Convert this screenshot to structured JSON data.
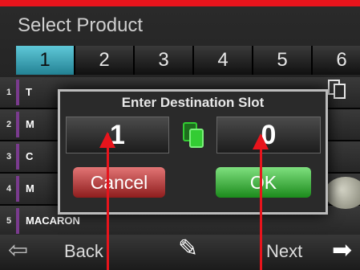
{
  "header": {
    "title": "Select Product"
  },
  "tabs": [
    "1",
    "2",
    "3",
    "4",
    "5",
    "6"
  ],
  "rows": [
    {
      "number": "1",
      "name": "T"
    },
    {
      "number": "2",
      "name": "M"
    },
    {
      "number": "3",
      "name": "C"
    },
    {
      "number": "4",
      "name": "M"
    },
    {
      "number": "5",
      "name": "MACARON"
    }
  ],
  "dialog": {
    "title": "Enter Destination Slot",
    "source_slot": "1",
    "destination_slot": "0",
    "cancel_label": "Cancel",
    "ok_label": "OK"
  },
  "footer": {
    "back_label": "Back",
    "next_label": "Next"
  },
  "icons": {
    "back": "back-arrow-icon",
    "edit": "pencil-icon",
    "next": "right-arrow-icon",
    "copy": "copy-icon"
  },
  "colors": {
    "annotation_red": "#e8141c",
    "active_tab": "#3fb3c6",
    "ok_green": "#2db02d",
    "cancel_red": "#b83232",
    "copy_green": "#33cc33"
  }
}
